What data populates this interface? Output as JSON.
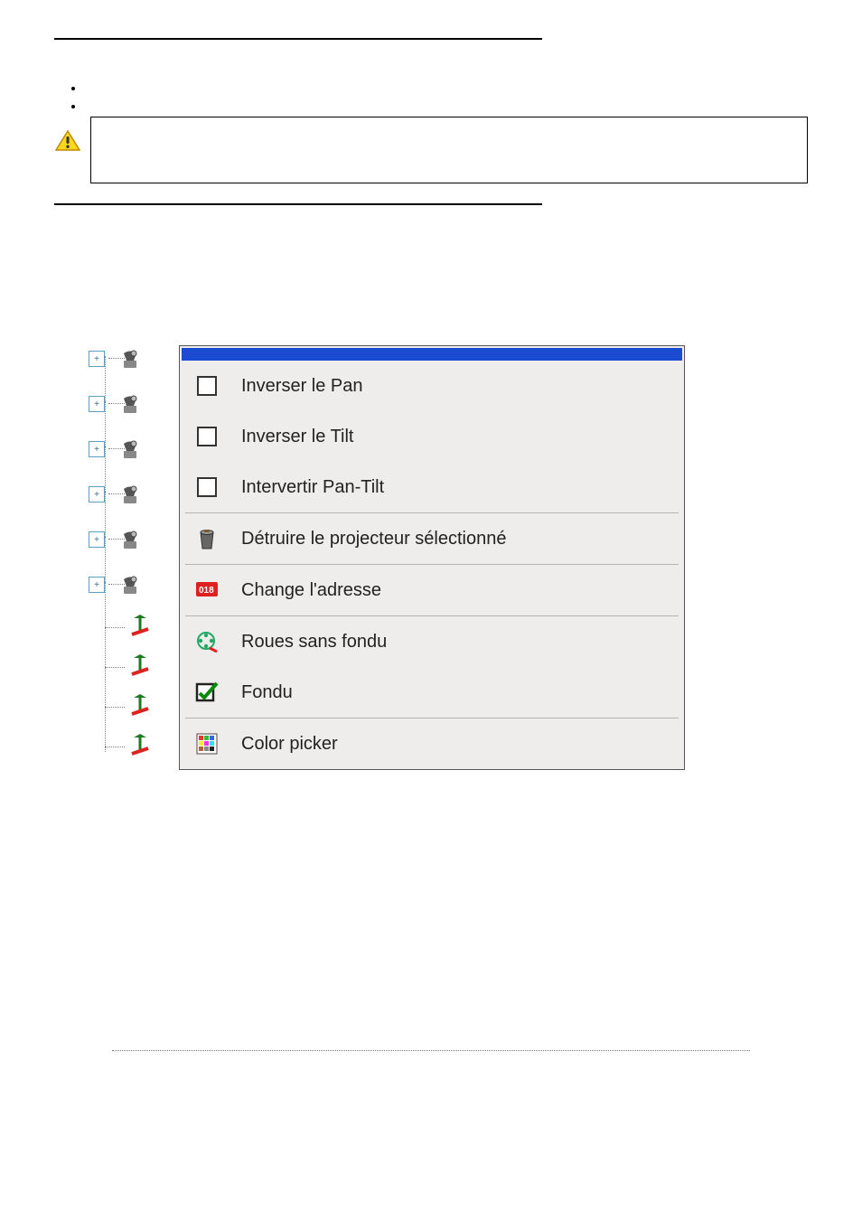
{
  "menu": {
    "items": [
      {
        "label": "Inverser le Pan"
      },
      {
        "label": "Inverser le Tilt"
      },
      {
        "label": "Intervertir Pan-Tilt"
      },
      {
        "label": "Détruire le projecteur sélectionné"
      },
      {
        "label": "Change l'adresse"
      },
      {
        "label": "Roues sans fondu"
      },
      {
        "label": "Fondu"
      },
      {
        "label": "Color picker"
      }
    ]
  }
}
